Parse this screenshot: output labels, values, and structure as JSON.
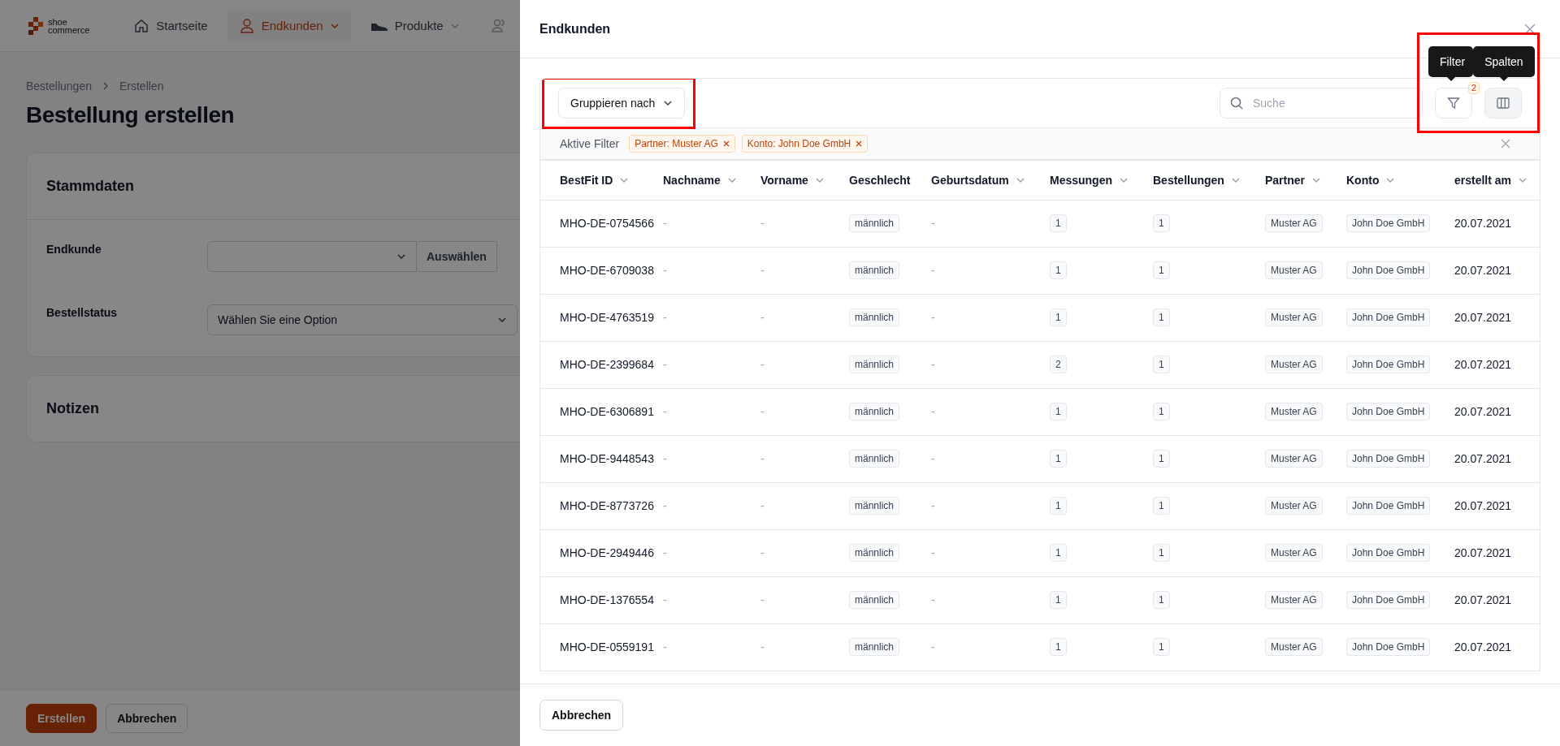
{
  "app": {
    "logo": {
      "line_1": "shoe",
      "line_2": "commerce"
    },
    "nav": [
      {
        "kind": "home",
        "label": "Startseite",
        "dropdown": false,
        "selected": false
      },
      {
        "kind": "person",
        "label": "Endkunden",
        "dropdown": true,
        "selected": true
      },
      {
        "kind": "shoe",
        "label": "Produkte",
        "dropdown": true,
        "selected": false
      },
      {
        "kind": "people",
        "dropdown": false,
        "selected": false
      }
    ]
  },
  "page": {
    "breadcrumb": [
      "Bestellungen",
      "Erstellen"
    ],
    "title": "Bestellung erstellen",
    "sections": [
      {
        "title": "Stammdaten",
        "fields": [
          {
            "kind": "lookup",
            "label": "Endkunde",
            "button": "Auswählen"
          },
          {
            "kind": "select",
            "label": "Bestellstatus",
            "placeholder": "Wählen Sie eine Option"
          }
        ]
      },
      {
        "title": "Notizen"
      }
    ],
    "actions": [
      {
        "label": "Erstellen",
        "primary": true
      },
      {
        "label": "Abbrechen",
        "primary": false
      }
    ]
  },
  "modal": {
    "title": "Endkunden",
    "group_by": {
      "label": "Gruppieren nach",
      "highlighted": true
    },
    "search": {
      "placeholder": "Suche"
    },
    "tools_highlighted": true,
    "tools": [
      {
        "kind": "filter",
        "tooltip": "Filter",
        "badge": "2",
        "active": false
      },
      {
        "kind": "columns",
        "tooltip": "Spalten",
        "active": true
      }
    ],
    "active_filters": {
      "label": "Aktive Filter",
      "chips": [
        "Partner: Muster AG",
        "Konto: John Doe GmbH"
      ]
    },
    "table": {
      "columns": [
        {
          "label": "BestFit ID",
          "kind": "text",
          "sortable": true
        },
        {
          "label": "Nachname",
          "kind": "text",
          "sortable": true
        },
        {
          "label": "Vorname",
          "kind": "text",
          "sortable": true
        },
        {
          "label": "Geschlecht",
          "kind": "tag",
          "sortable": false
        },
        {
          "label": "Geburtsdatum",
          "kind": "text",
          "sortable": true
        },
        {
          "label": "Messungen",
          "kind": "tag",
          "sortable": true
        },
        {
          "label": "Bestellungen",
          "kind": "tag",
          "sortable": true
        },
        {
          "label": "Partner",
          "kind": "tag",
          "sortable": true
        },
        {
          "label": "Konto",
          "kind": "tag",
          "sortable": true
        },
        {
          "label": "erstellt am",
          "kind": "text",
          "sortable": true
        }
      ],
      "rows": [
        [
          "MHO-DE-0754566",
          "-",
          "-",
          "männlich",
          "-",
          "1",
          "1",
          "Muster AG",
          "John Doe GmbH",
          "20.07.2021"
        ],
        [
          "MHO-DE-6709038",
          "-",
          "-",
          "männlich",
          "-",
          "1",
          "1",
          "Muster AG",
          "John Doe GmbH",
          "20.07.2021"
        ],
        [
          "MHO-DE-4763519",
          "-",
          "-",
          "männlich",
          "-",
          "1",
          "1",
          "Muster AG",
          "John Doe GmbH",
          "20.07.2021"
        ],
        [
          "MHO-DE-2399684",
          "-",
          "-",
          "männlich",
          "-",
          "2",
          "1",
          "Muster AG",
          "John Doe GmbH",
          "20.07.2021"
        ],
        [
          "MHO-DE-6306891",
          "-",
          "-",
          "männlich",
          "-",
          "1",
          "1",
          "Muster AG",
          "John Doe GmbH",
          "20.07.2021"
        ],
        [
          "MHO-DE-9448543",
          "-",
          "-",
          "männlich",
          "-",
          "1",
          "1",
          "Muster AG",
          "John Doe GmbH",
          "20.07.2021"
        ],
        [
          "MHO-DE-8773726",
          "-",
          "-",
          "männlich",
          "-",
          "1",
          "1",
          "Muster AG",
          "John Doe GmbH",
          "20.07.2021"
        ],
        [
          "MHO-DE-2949446",
          "-",
          "-",
          "männlich",
          "-",
          "1",
          "1",
          "Muster AG",
          "John Doe GmbH",
          "20.07.2021"
        ],
        [
          "MHO-DE-1376554",
          "-",
          "-",
          "männlich",
          "-",
          "1",
          "1",
          "Muster AG",
          "John Doe GmbH",
          "20.07.2021"
        ],
        [
          "MHO-DE-0559191",
          "-",
          "-",
          "männlich",
          "-",
          "1",
          "1",
          "Muster AG",
          "John Doe GmbH",
          "20.07.2021"
        ]
      ]
    },
    "footer": {
      "cancel": "Abbrechen"
    }
  }
}
